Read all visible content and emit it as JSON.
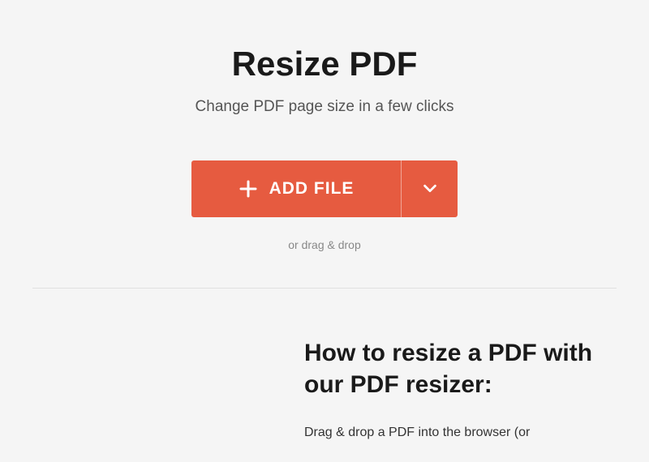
{
  "hero": {
    "title": "Resize PDF",
    "subtitle": "Change PDF page size in a few clicks",
    "add_file_label": "ADD FILE",
    "drag_drop_text": "or drag & drop"
  },
  "howto": {
    "title": "How to resize a PDF with our PDF resizer:",
    "paragraph": "Drag & drop a PDF into the browser (or"
  },
  "colors": {
    "accent": "#e65b40"
  }
}
